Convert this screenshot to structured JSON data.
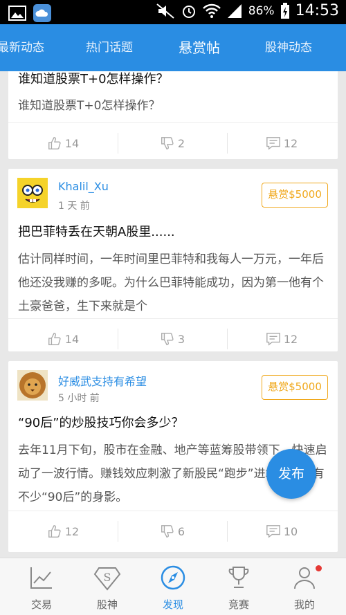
{
  "status_bar": {
    "battery": "86%",
    "time": "14:53"
  },
  "tabs": [
    {
      "label": "最新动态"
    },
    {
      "label": "热门话题"
    },
    {
      "label": "悬赏帖"
    },
    {
      "label": "股神动态"
    }
  ],
  "posts": [
    {
      "title": "谁知道股票T+0怎样操作？",
      "body": "谁知道股票T+0怎样操作？",
      "likes": "14",
      "dislikes": "2",
      "comments": "12"
    },
    {
      "username": "Khalil_Xu",
      "time": "1 天 前",
      "bounty": "悬赏$5000",
      "title": "把巴菲特丢在天朝A股里......",
      "body": "估计同样时间，一年时间里巴菲特和我每人一万元，一年后他还没我赚的多呢。为什么巴菲特能成功，因为第一他有个土豪爸爸，生下来就是个",
      "likes": "14",
      "dislikes": "3",
      "comments": "12"
    },
    {
      "username": "好威武支持有希望",
      "time": "5 小时 前",
      "bounty": "悬赏$5000",
      "title": "“90后”的炒股技巧你会多少？",
      "body": "去年11月下旬，股市在金融、地产等蓝筹股带领下，快速启动了一波行情。赚钱效应刺激了新股民“跑步”进场，其中有不少“90后”的身影。",
      "likes": "12",
      "dislikes": "6",
      "comments": "10"
    }
  ],
  "fab": {
    "label": "发布"
  },
  "bottom_nav": [
    {
      "label": "交易",
      "icon": "chart-icon"
    },
    {
      "label": "股神",
      "icon": "superman-s-icon"
    },
    {
      "label": "发现",
      "icon": "compass-icon"
    },
    {
      "label": "竞赛",
      "icon": "trophy-icon"
    },
    {
      "label": "我的",
      "icon": "person-icon"
    }
  ],
  "colors": {
    "accent": "#2a8de3",
    "bounty": "#f0a81c"
  }
}
